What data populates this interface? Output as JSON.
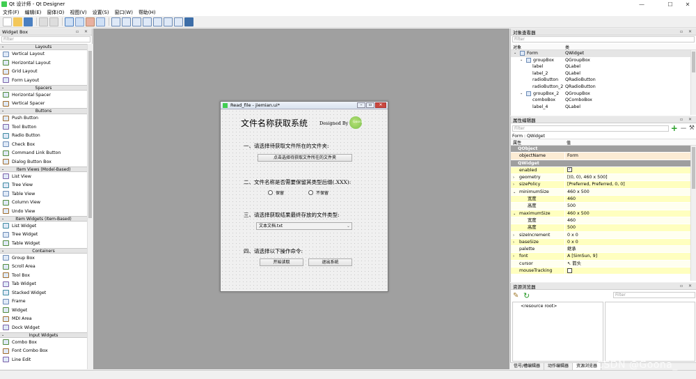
{
  "window": {
    "title": "Qt 设计师 - Qt Designer",
    "min": "—",
    "max": "☐",
    "close": "✕"
  },
  "menubar": [
    "文件(F)",
    "编辑(E)",
    "窗体(O)",
    "视图(V)",
    "设置(S)",
    "窗口(W)",
    "帮助(H)"
  ],
  "widget_box": {
    "title": "Widget Box",
    "filter_placeholder": "Filter",
    "categories": [
      {
        "name": "Layouts",
        "items": [
          "Vertical Layout",
          "Horizontal Layout",
          "Grid Layout",
          "Form Layout"
        ]
      },
      {
        "name": "Spacers",
        "items": [
          "Horizontal Spacer",
          "Vertical Spacer"
        ]
      },
      {
        "name": "Buttons",
        "items": [
          "Push Button",
          "Tool Button",
          "Radio Button",
          "Check Box",
          "Command Link Button",
          "Dialog Button Box"
        ]
      },
      {
        "name": "Item Views (Model-Based)",
        "items": [
          "List View",
          "Tree View",
          "Table View",
          "Column View",
          "Undo View"
        ]
      },
      {
        "name": "Item Widgets (Item-Based)",
        "items": [
          "List Widget",
          "Tree Widget",
          "Table Widget"
        ]
      },
      {
        "name": "Containers",
        "items": [
          "Group Box",
          "Scroll Area",
          "Tool Box",
          "Tab Widget",
          "Stacked Widget",
          "Frame",
          "Widget",
          "MDI Area",
          "Dock Widget"
        ]
      },
      {
        "name": "Input Widgets",
        "items": [
          "Combo Box",
          "Font Combo Box",
          "Line Edit"
        ]
      }
    ]
  },
  "form": {
    "window_title": "Read_file - jiemian.ui*",
    "heading": "文件名称获取系统",
    "designed_by": "Designed By",
    "logo_text": "Goona",
    "step1": "一、请选择待获取文件所在的文件夹:",
    "step1_button": "点击选择待获取文件所在的文件夹",
    "step2": "二、文件名称是否需要保留其类型后缀(.XXX):",
    "radio_keep": "保留",
    "radio_discard": "不保留",
    "step3": "三、请选择获取结果最终存放的文件类型:",
    "combo_value": "文本文档.txt",
    "step4": "四、请选择以下操作命令:",
    "start_button": "开始读取",
    "exit_button": "退出系统"
  },
  "object_inspector": {
    "title": "对象查看器",
    "filter_placeholder": "Filter",
    "col_object": "对象",
    "col_class": "类",
    "rows": [
      {
        "obj": "Form",
        "cls": "QWidget",
        "level": 0,
        "exp": "⌄"
      },
      {
        "obj": "groupBox",
        "cls": "QGroupBox",
        "level": 1,
        "exp": "⌄"
      },
      {
        "obj": "label",
        "cls": "QLabel",
        "level": 2,
        "exp": ""
      },
      {
        "obj": "label_2",
        "cls": "QLabel",
        "level": 2,
        "exp": ""
      },
      {
        "obj": "radioButton",
        "cls": "QRadioButton",
        "level": 2,
        "exp": ""
      },
      {
        "obj": "radioButton_2",
        "cls": "QRadioButton",
        "level": 2,
        "exp": ""
      },
      {
        "obj": "groupBox_2",
        "cls": "QGroupBox",
        "level": 1,
        "exp": "⌄"
      },
      {
        "obj": "comboBox",
        "cls": "QComboBox",
        "level": 2,
        "exp": ""
      },
      {
        "obj": "label_4",
        "cls": "QLabel",
        "level": 2,
        "exp": ""
      }
    ]
  },
  "property_editor": {
    "title": "属性编辑器",
    "filter_placeholder": "Filter",
    "path": "Form : QWidget",
    "col_property": "属性",
    "col_value": "值",
    "rows": [
      {
        "name": "QObject",
        "value": "",
        "style": "group"
      },
      {
        "name": "objectName",
        "value": "Form",
        "style": "beige"
      },
      {
        "name": "QWidget",
        "value": "",
        "style": "group"
      },
      {
        "name": "enabled",
        "value": "✓",
        "style": "yel",
        "check": true
      },
      {
        "name": "geometry",
        "value": "[(0, 0), 460 x 500]",
        "style": "yel2",
        "exp": "›"
      },
      {
        "name": "sizePolicy",
        "value": "[Preferred, Preferred, 0, 0]",
        "style": "yel",
        "exp": "›"
      },
      {
        "name": "minimumSize",
        "value": "460 x 500",
        "style": "yel2",
        "exp": "⌄"
      },
      {
        "name": "宽度",
        "value": "460",
        "style": "yel sub"
      },
      {
        "name": "高度",
        "value": "500",
        "style": "yel2 sub"
      },
      {
        "name": "maximumSize",
        "value": "460 x 500",
        "style": "yel",
        "exp": "⌄"
      },
      {
        "name": "宽度",
        "value": "460",
        "style": "yel2 sub"
      },
      {
        "name": "高度",
        "value": "500",
        "style": "yel sub"
      },
      {
        "name": "sizeIncrement",
        "value": "0 x 0",
        "style": "yel2",
        "exp": "›"
      },
      {
        "name": "baseSize",
        "value": "0 x 0",
        "style": "yel",
        "exp": "›"
      },
      {
        "name": "palette",
        "value": "继承",
        "style": "yel2"
      },
      {
        "name": "font",
        "value": "A [SimSun, 9]",
        "style": "yel",
        "exp": "›"
      },
      {
        "name": "cursor",
        "value": "↖ 箭头",
        "style": "yel2"
      },
      {
        "name": "mouseTracking",
        "value": "",
        "style": "yel",
        "check": true
      }
    ]
  },
  "resource_browser": {
    "title": "资源浏览器",
    "filter_placeholder": "Filter",
    "root": "<resource root>"
  },
  "bottom_tabs": [
    "信号/槽编辑器",
    "动作编辑器",
    "资源浏览器"
  ],
  "watermark": "CSDN @Goona_"
}
